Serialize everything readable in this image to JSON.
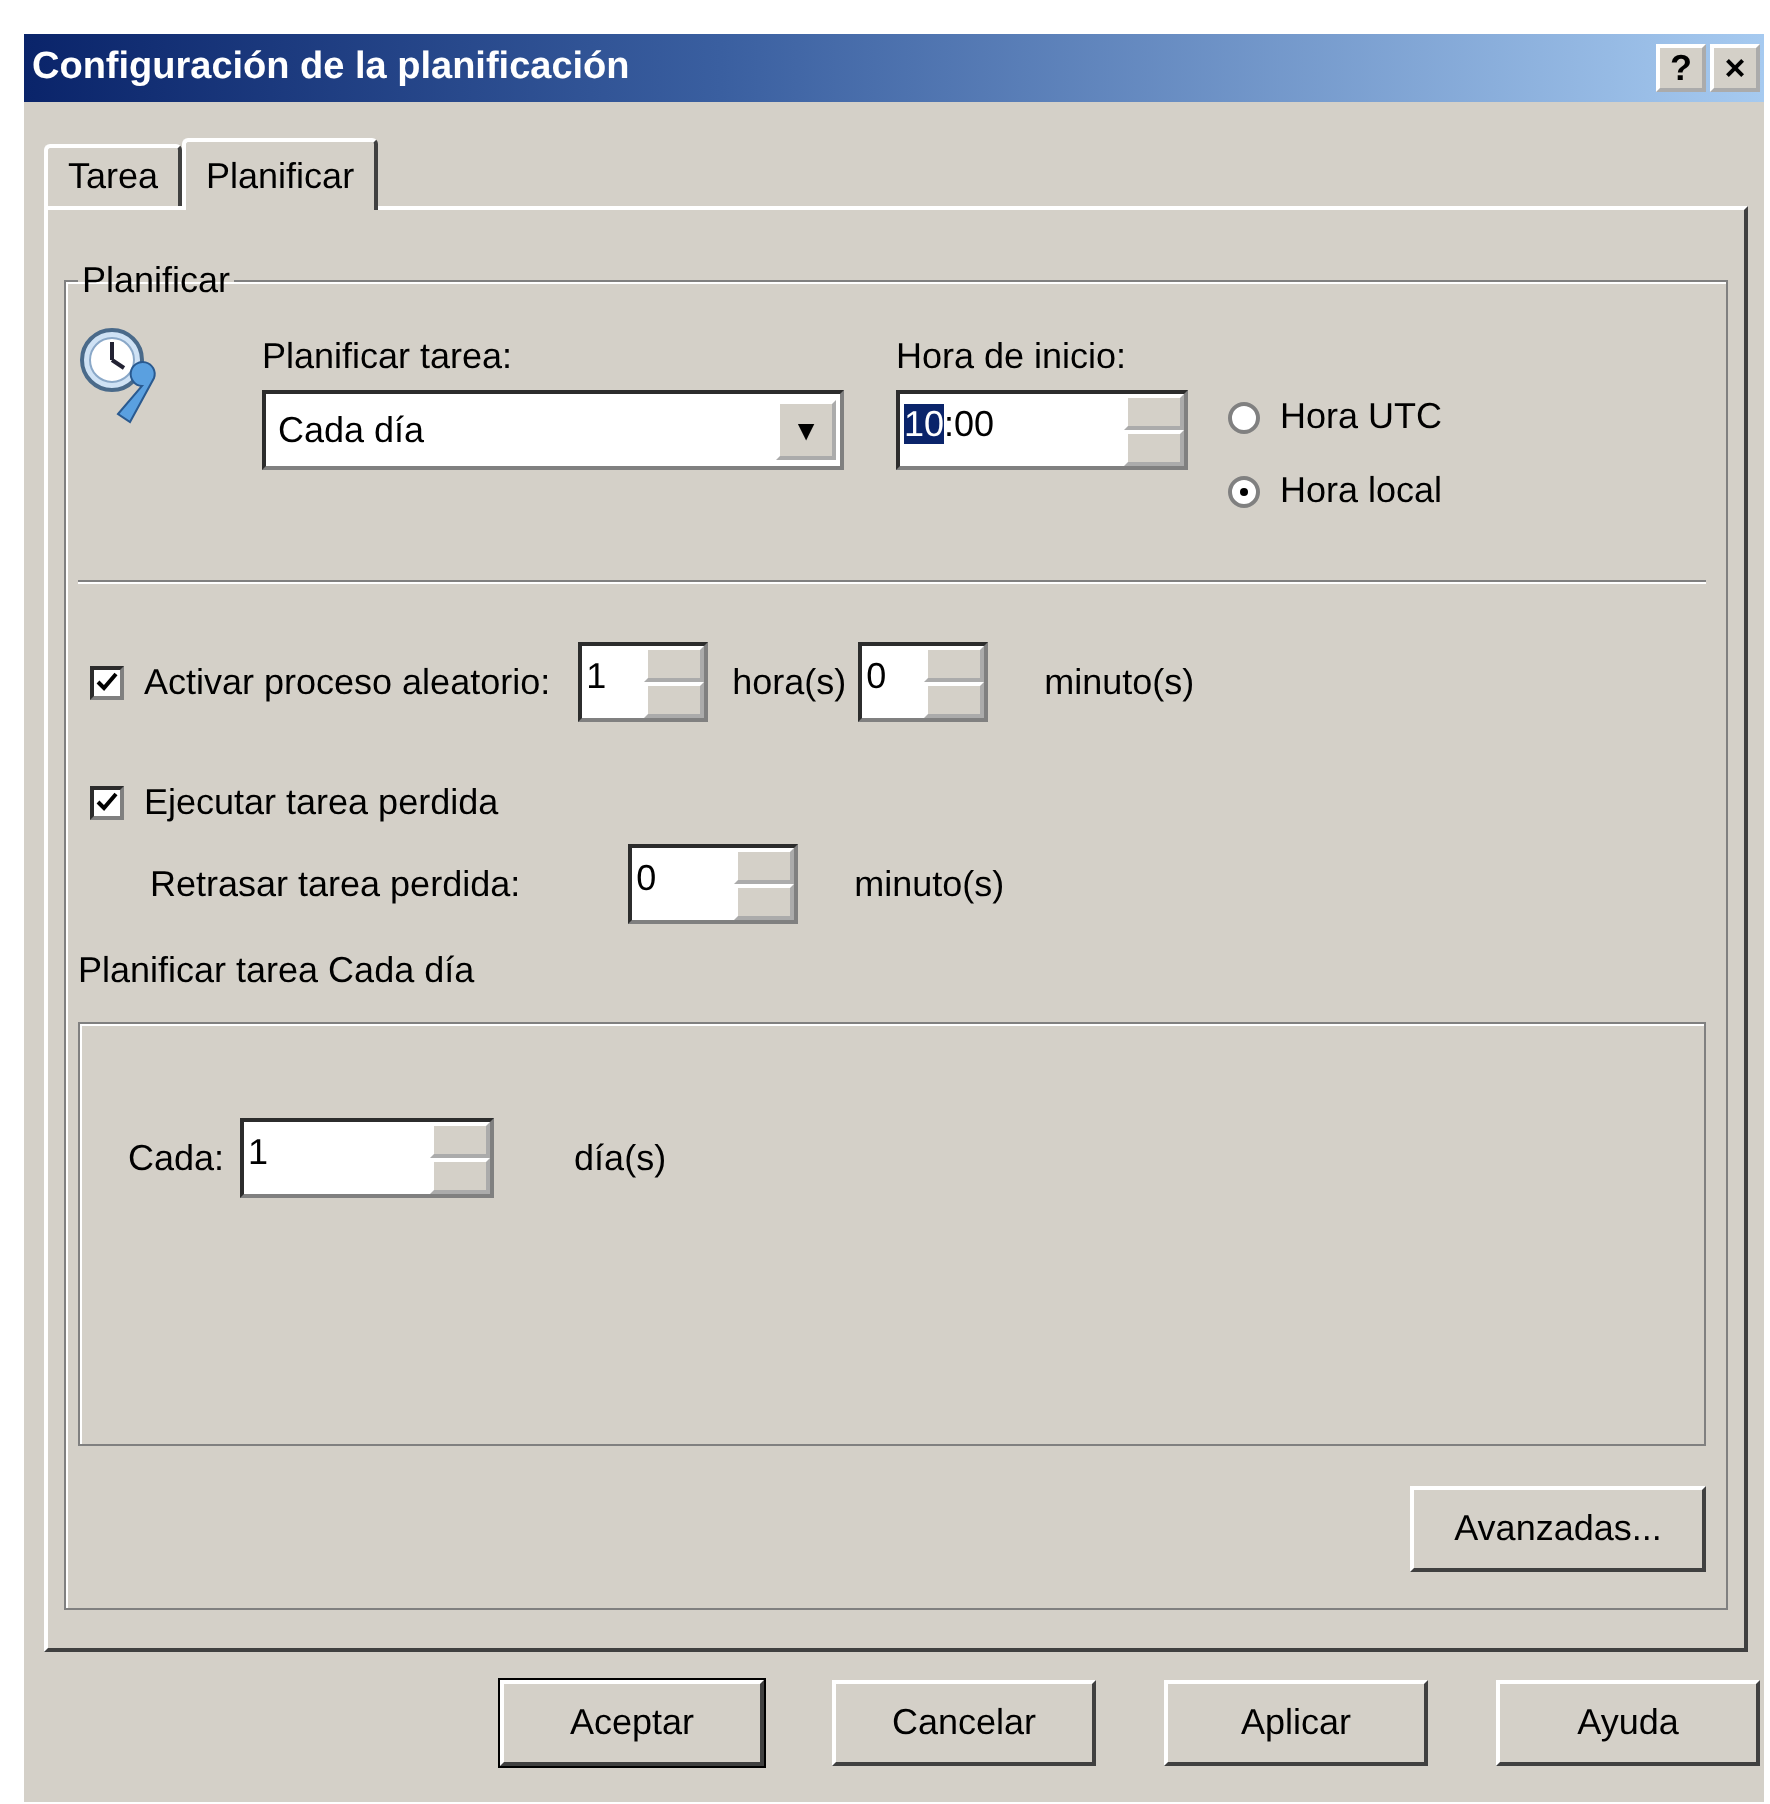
{
  "window": {
    "title": "Configuración de la planificación",
    "title_buttons": [
      "?",
      "×"
    ]
  },
  "tabs": [
    {
      "label": "Tarea",
      "selected": false
    },
    {
      "label": "Planificar",
      "selected": true
    }
  ],
  "group": {
    "legend": "Planificar",
    "schedule": {
      "label": "Planificar tarea:",
      "value": "Cada día",
      "arrow": "▼"
    },
    "start_time": {
      "label": "Hora de inicio:",
      "hours": "10",
      "separator": ":",
      "minutes": "00",
      "hours_selected": true
    },
    "time_mode": [
      {
        "label": "Hora UTC",
        "selected": false
      },
      {
        "label": "Hora local",
        "selected": true
      }
    ],
    "random": {
      "label": "Activar proceso aleatorio:",
      "checked": true,
      "hours": "1",
      "hours_unit": "hora(s)",
      "minutes": "0",
      "minutes_unit": "minuto(s)"
    },
    "missed": {
      "label": "Ejecutar tarea perdida",
      "checked": true,
      "delay_label": "Retrasar tarea perdida:",
      "delay": "0",
      "delay_unit": "minuto(s)"
    },
    "detail_title": "Planificar tarea Cada día",
    "every": {
      "label": "Cada:",
      "value": "1",
      "unit": "día(s)"
    },
    "advanced_button": "Avanzadas..."
  },
  "buttons": [
    {
      "label": "Aceptar",
      "default": true
    },
    {
      "label": "Cancelar",
      "default": false
    },
    {
      "label": "Aplicar",
      "default": false
    },
    {
      "label": "Ayuda",
      "default": false
    }
  ]
}
